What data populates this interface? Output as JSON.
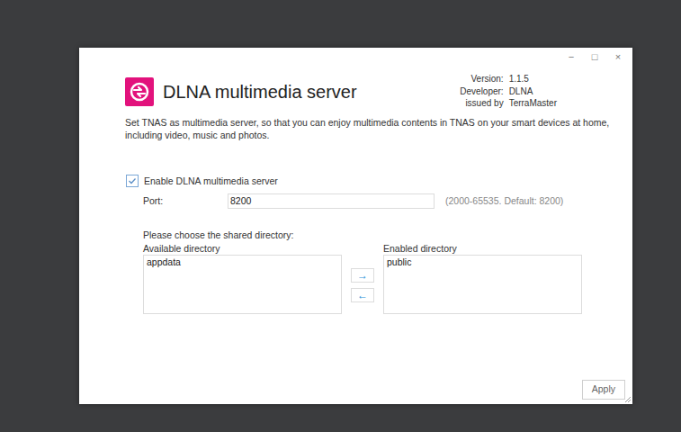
{
  "window": {
    "controls": [
      "−",
      "□",
      "×"
    ]
  },
  "app": {
    "title": "DLNA multimedia server",
    "info": [
      {
        "label": "Version:",
        "value": "1.1.5"
      },
      {
        "label": "Developer:",
        "value": "DLNA"
      },
      {
        "label": "issued by",
        "value": "TerraMaster"
      }
    ],
    "description": "Set TNAS as multimedia server, so that you can enjoy multimedia contents in TNAS on your smart devices at home, including video, music and photos."
  },
  "enable": {
    "label": "Enable DLNA multimedia server",
    "checked": true
  },
  "port": {
    "label": "Port:",
    "value": "8200",
    "hint": "(2000-65535. Default: 8200)"
  },
  "directories": {
    "prompt": "Please choose the shared directory:",
    "available": {
      "label": "Available directory",
      "items": [
        {
          "name": "appdata",
          "selected": false
        }
      ]
    },
    "enabled": {
      "label": "Enabled directory",
      "items": [
        {
          "name": "public",
          "selected": false
        }
      ]
    },
    "move_buttons": [
      "→",
      "←"
    ]
  },
  "buttons": [
    "Apply"
  ]
}
